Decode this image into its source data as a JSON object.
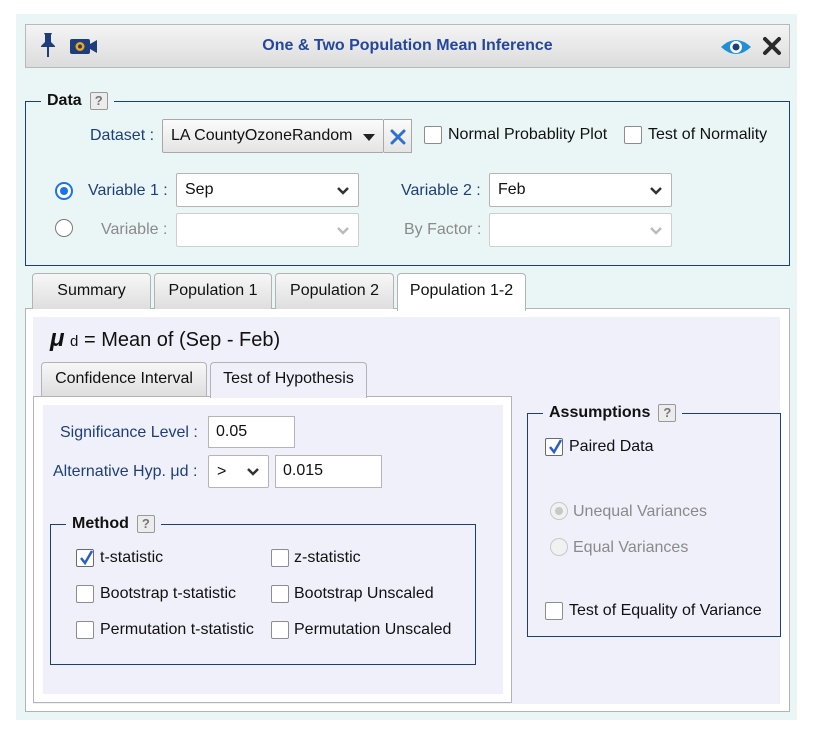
{
  "window": {
    "title": "One & Two Population Mean Inference"
  },
  "data_panel": {
    "legend": "Data",
    "help": "?",
    "dataset_label": "Dataset :",
    "dataset_value": "LA CountyOzoneRandom",
    "normal_plot_label": "Normal Probablity Plot",
    "normality_test_label": "Test of Normality",
    "variable1_label": "Variable 1 :",
    "variable1_value": "Sep",
    "variable2_label": "Variable 2 :",
    "variable2_value": "Feb",
    "variable_label": "Variable :",
    "variable_value": "",
    "byfactor_label": "By Factor :",
    "byfactor_value": ""
  },
  "tabs": [
    {
      "label": "Summary"
    },
    {
      "label": "Population 1"
    },
    {
      "label": "Population 2"
    },
    {
      "label": "Population 1-2",
      "active": true
    }
  ],
  "population_diff": {
    "mu_symbol": "μ",
    "mu_sub": "d",
    "heading_text": "= Mean of (Sep - Feb)"
  },
  "subtabs": [
    {
      "label": "Confidence Interval"
    },
    {
      "label": "Test of Hypothesis",
      "active": true
    }
  ],
  "hypothesis": {
    "significance_label": "Significance Level :",
    "significance_value": "0.05",
    "alt_label": "Alternative Hyp. μd :",
    "alt_operator": ">",
    "alt_value": "0.015"
  },
  "method": {
    "legend": "Method",
    "help": "?",
    "options": [
      {
        "label": "t-statistic",
        "checked": true
      },
      {
        "label": "z-statistic",
        "checked": false
      },
      {
        "label": "Bootstrap t-statistic",
        "checked": false
      },
      {
        "label": "Bootstrap Unscaled",
        "checked": false
      },
      {
        "label": "Permutation t-statistic",
        "checked": false
      },
      {
        "label": "Permutation Unscaled",
        "checked": false
      }
    ]
  },
  "assumptions": {
    "legend": "Assumptions",
    "help": "?",
    "paired_label": "Paired Data",
    "paired_checked": true,
    "unequal_label": "Unequal Variances",
    "equal_label": "Equal Variances",
    "equality_test_label": "Test of Equality of Variance",
    "equality_test_checked": false
  },
  "colors": {
    "accent": "#1a73e8",
    "title": "#25479b",
    "label_blue": "#1d3f78",
    "background": "#eaf6f6"
  }
}
